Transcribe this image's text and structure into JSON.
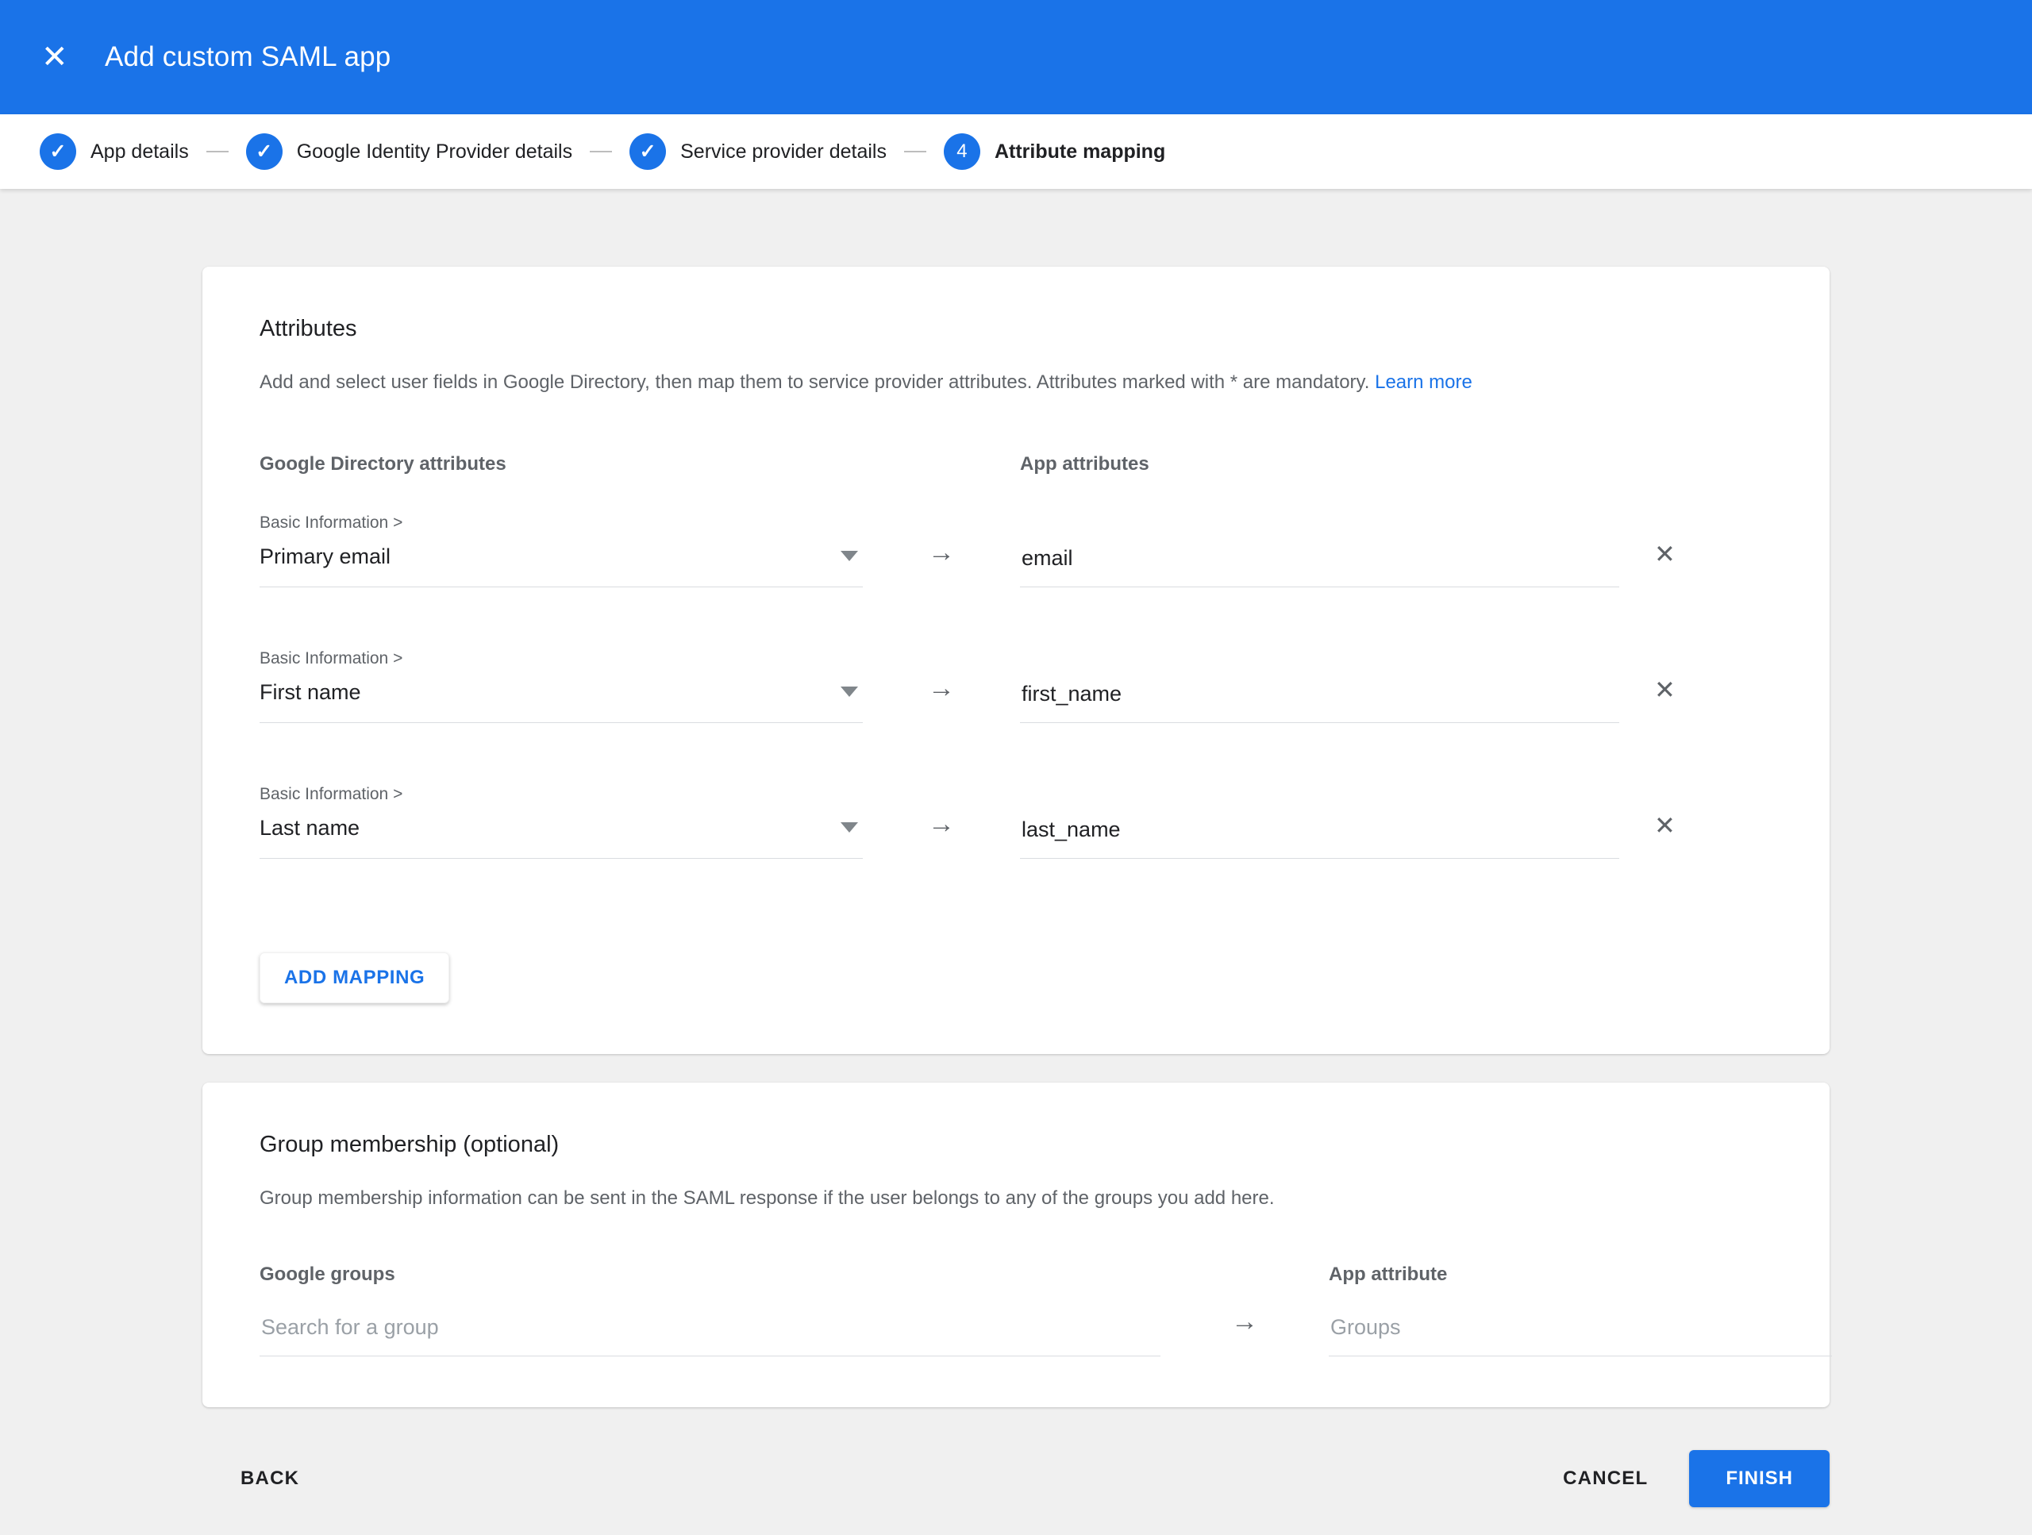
{
  "header": {
    "title": "Add custom SAML app"
  },
  "icons": {
    "close": "✕",
    "check": "✓",
    "arrow": "→"
  },
  "stepper": {
    "steps": [
      {
        "label": "App details",
        "state": "complete"
      },
      {
        "label": "Google Identity Provider details",
        "state": "complete"
      },
      {
        "label": "Service provider details",
        "state": "complete"
      },
      {
        "label": "Attribute mapping",
        "state": "current",
        "number": "4"
      }
    ]
  },
  "attributes_card": {
    "title": "Attributes",
    "description": "Add and select user fields in Google Directory, then map them to service provider attributes. Attributes marked with * are mandatory.",
    "learn_more_label": "Learn more",
    "left_column_header": "Google Directory attributes",
    "right_column_header": "App attributes",
    "mappings": [
      {
        "category": "Basic Information >",
        "directory_attribute": "Primary email",
        "app_attribute": "email"
      },
      {
        "category": "Basic Information >",
        "directory_attribute": "First name",
        "app_attribute": "first_name"
      },
      {
        "category": "Basic Information >",
        "directory_attribute": "Last name",
        "app_attribute": "last_name"
      }
    ],
    "add_mapping_label": "ADD MAPPING"
  },
  "group_card": {
    "title": "Group membership (optional)",
    "description": "Group membership information can be sent in the SAML response if the user belongs to any of the groups you add here.",
    "left_column_header": "Google groups",
    "right_column_header": "App attribute",
    "group_search_placeholder": "Search for a group",
    "app_attribute_placeholder": "Groups"
  },
  "footer": {
    "back_label": "BACK",
    "cancel_label": "CANCEL",
    "finish_label": "FINISH"
  },
  "colors": {
    "primary_blue": "#1a73e8",
    "text_dark": "#202124",
    "text_gray": "#5f6368",
    "underline_gray": "#dadce0"
  }
}
